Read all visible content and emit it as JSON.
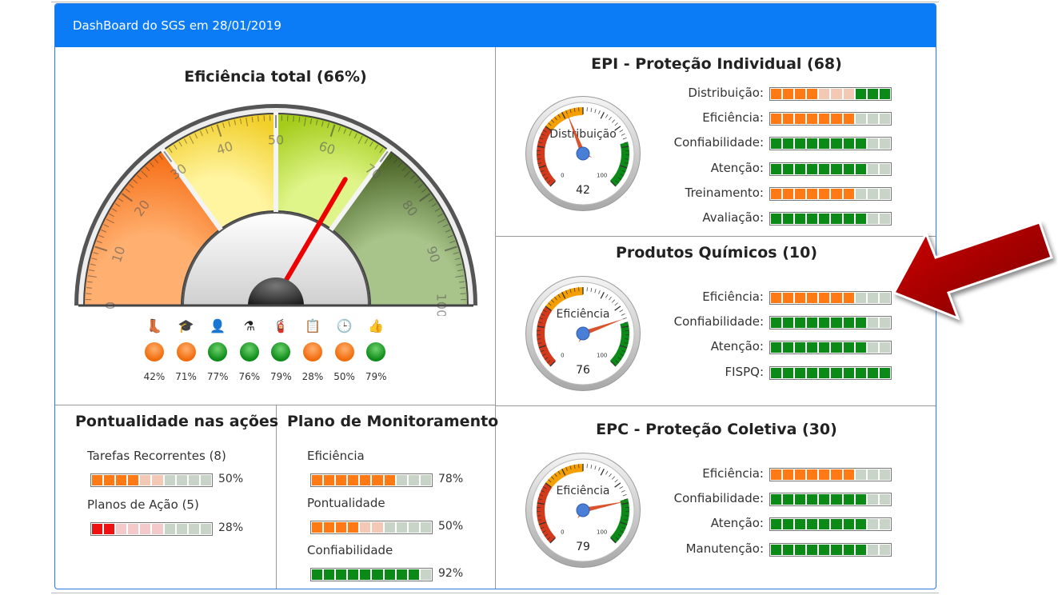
{
  "header": {
    "title": "DashBoard do SGS em 28/01/2019"
  },
  "total": {
    "title": "Eficiência total (66%)",
    "value": 66,
    "scale_labels": [
      "0",
      "10",
      "20",
      "30",
      "40",
      "50",
      "60",
      "70",
      "80",
      "90",
      "100"
    ],
    "indicators": [
      {
        "icon": "boot-icon",
        "glyph": "👢",
        "status": "o",
        "pct": "42%"
      },
      {
        "icon": "graduation-cap-icon",
        "glyph": "🎓",
        "status": "o",
        "pct": "71%"
      },
      {
        "icon": "user-check-icon",
        "glyph": "👤",
        "status": "g",
        "pct": "77%"
      },
      {
        "icon": "flask-icon",
        "glyph": "⚗",
        "status": "g",
        "pct": "76%"
      },
      {
        "icon": "fire-extinguisher-icon",
        "glyph": "🧯",
        "status": "g",
        "pct": "79%"
      },
      {
        "icon": "clipboard-check-icon",
        "glyph": "📋",
        "status": "o",
        "pct": "28%"
      },
      {
        "icon": "clock-icon",
        "glyph": "🕒",
        "status": "o",
        "pct": "50%"
      },
      {
        "icon": "thumbs-up-icon",
        "glyph": "👍",
        "status": "g",
        "pct": "79%"
      }
    ]
  },
  "epi": {
    "title": "EPI - Proteção Individual (68)",
    "gauge": {
      "label": "Distribuição",
      "value": 42,
      "min_label": "0",
      "max_label": "100"
    },
    "bars": [
      {
        "label": "Distribuição:",
        "segs": "ooooo2o2o2ggg"
      },
      {
        "label": "Eficiência:",
        "segs": "oooooooxxx"
      },
      {
        "label": "Confiabilidade:",
        "segs": "ggggggggxx"
      },
      {
        "label": "Atenção:",
        "segs": "ggggggggxx"
      },
      {
        "label": "Treinamento:",
        "segs": "oooooooxxx"
      },
      {
        "label": "Avaliação:",
        "segs": "ggggggggxx"
      }
    ]
  },
  "quimicos": {
    "title": "Produtos Químicos (10)",
    "gauge": {
      "label": "Eficiência",
      "value": 76,
      "min_label": "0",
      "max_label": "100"
    },
    "bars": [
      {
        "label": "Eficiência:",
        "segs": "oooooooxxx"
      },
      {
        "label": "Confiabilidade:",
        "segs": "ggggggggxx"
      },
      {
        "label": "Atenção:",
        "segs": "ggggggggxx"
      },
      {
        "label": "FISPQ:",
        "segs": "gggggggggg"
      }
    ]
  },
  "epc": {
    "title": "EPC - Proteção Coletiva (30)",
    "gauge": {
      "label": "Eficiência",
      "value": 79,
      "min_label": "0",
      "max_label": "100"
    },
    "bars": [
      {
        "label": "Eficiência:",
        "segs": "oooooooxxx"
      },
      {
        "label": "Confiabilidade:",
        "segs": "ggggggggxx"
      },
      {
        "label": "Atenção:",
        "segs": "ggggggggxx"
      },
      {
        "label": "Manutenção:",
        "segs": "ggggggggxx"
      }
    ]
  },
  "pontualidade": {
    "title": "Pontualidade nas ações",
    "items": [
      {
        "label": "Tarefas Recorrentes (8)",
        "segs": "ooooo2o2xxx",
        "pct": "50%"
      },
      {
        "label": "Planos de Ação (5)",
        "segs": "rrr2r2r2r2xx",
        "pct": "28%"
      }
    ]
  },
  "monitoramento": {
    "title": "Plano de Monitoramento",
    "items": [
      {
        "label": "Eficiência",
        "segs": "oooooooxxx",
        "pct": "78%"
      },
      {
        "label": "Pontualidade",
        "segs": "ooooo2o2xxx",
        "pct": "50%"
      },
      {
        "label": "Confiabilidade",
        "segs": "gggggggggx",
        "pct": "92%"
      }
    ]
  },
  "arrow": {
    "color": "#b00000"
  }
}
